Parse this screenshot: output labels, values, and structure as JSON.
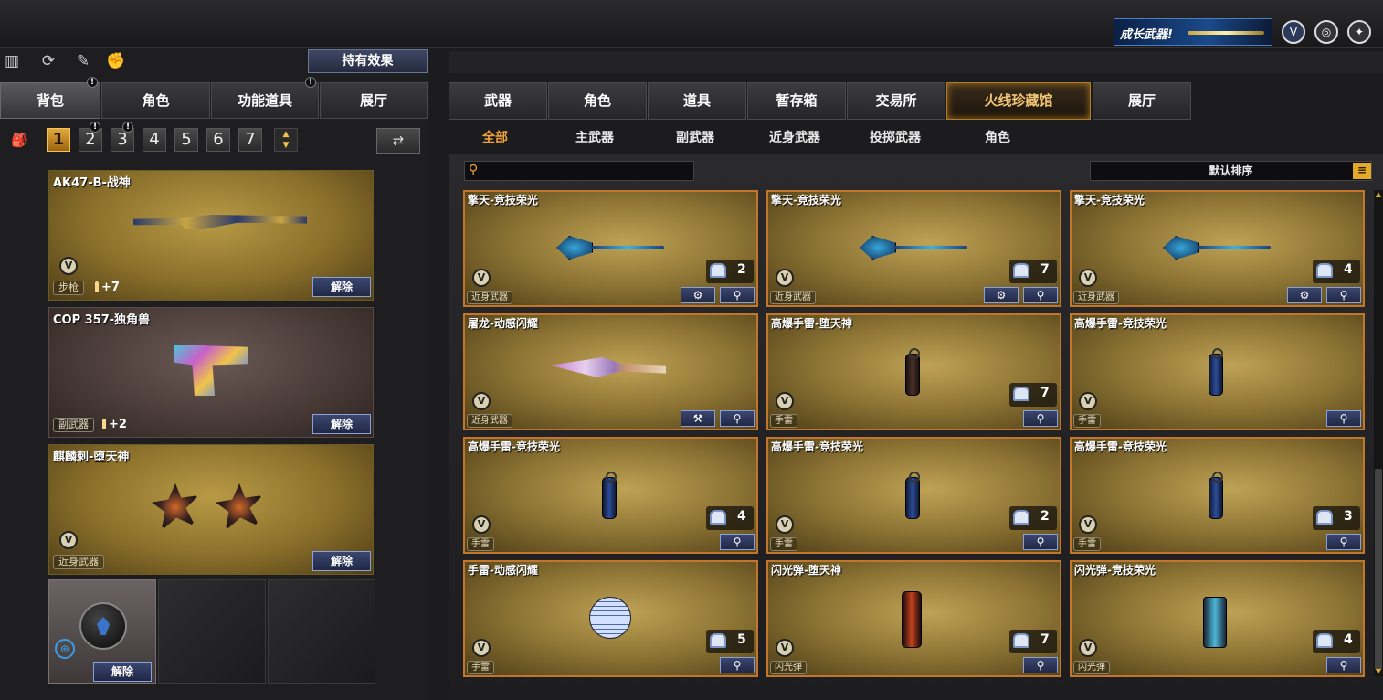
{
  "top": {
    "promo_text": "成长武器!",
    "icons": [
      "vip-shield-icon",
      "crosshair-globe-icon",
      "gift-tools-icon"
    ]
  },
  "left": {
    "toolbar_icons": [
      "stats-icon",
      "refresh-icon",
      "character-icon",
      "fist-icon"
    ],
    "effect_button": "持有效果",
    "tabs": [
      "背包",
      "角色",
      "功能道具",
      "展厅"
    ],
    "tab_alerts": [
      "!",
      "!"
    ],
    "pages": [
      "1",
      "2",
      "3",
      "4",
      "5",
      "6",
      "7"
    ],
    "page_alerts": [
      "!",
      "!"
    ],
    "equipped": [
      {
        "name": "AK47-B-战神",
        "badge": "V",
        "category": "步枪",
        "ammo": "+7",
        "remove": "解除"
      },
      {
        "name": "COP 357-独角兽",
        "category": "副武器",
        "ammo": "+2",
        "remove": "解除"
      },
      {
        "name": "麒麟刺-堕天神",
        "badge": "V",
        "category": "近身武器",
        "remove": "解除"
      }
    ],
    "extra_slot_remove": "解除"
  },
  "right": {
    "tabs": [
      "武器",
      "角色",
      "道具",
      "暂存箱",
      "交易所",
      "火线珍藏馆",
      "展厅"
    ],
    "active_tab": "火线珍藏馆",
    "subnav": [
      "全部",
      "主武器",
      "副武器",
      "近身武器",
      "投掷武器",
      "角色"
    ],
    "search_placeholder": "",
    "sort_label": "默认排序",
    "sort_list_icon": "≡",
    "items": [
      {
        "name": "擎天-竞技荣光",
        "badge": "V",
        "category": "近身武器",
        "count": "2"
      },
      {
        "name": "擎天-竞技荣光",
        "badge": "V",
        "category": "近身武器",
        "count": "7"
      },
      {
        "name": "擎天-竞技荣光",
        "badge": "V",
        "category": "近身武器",
        "count": "4"
      },
      {
        "name": "屠龙-动感闪耀",
        "badge": "V",
        "category": "近身武器",
        "count": ""
      },
      {
        "name": "高爆手雷-堕天神",
        "badge": "V",
        "category": "手雷",
        "count": "7"
      },
      {
        "name": "高爆手雷-竞技荣光",
        "badge": "V",
        "category": "手雷",
        "count": ""
      },
      {
        "name": "高爆手雷-竞技荣光",
        "badge": "V",
        "category": "手雷",
        "count": "4"
      },
      {
        "name": "高爆手雷-竞技荣光",
        "badge": "V",
        "category": "手雷",
        "count": "2"
      },
      {
        "name": "高爆手雷-竞技荣光",
        "badge": "V",
        "category": "手雷",
        "count": "3"
      },
      {
        "name": "手雷-动感闪耀",
        "badge": "V",
        "category": "手雷",
        "count": "5"
      },
      {
        "name": "闪光弹-堕天神",
        "badge": "V",
        "category": "闪光弹",
        "count": "7"
      },
      {
        "name": "闪光弹-竞技荣光",
        "badge": "V",
        "category": "闪光弹",
        "count": "4"
      }
    ]
  },
  "colors": {
    "accent_orange": "#f2a33a",
    "card_border": "#c4752c",
    "button_blue": "#3b4770"
  }
}
